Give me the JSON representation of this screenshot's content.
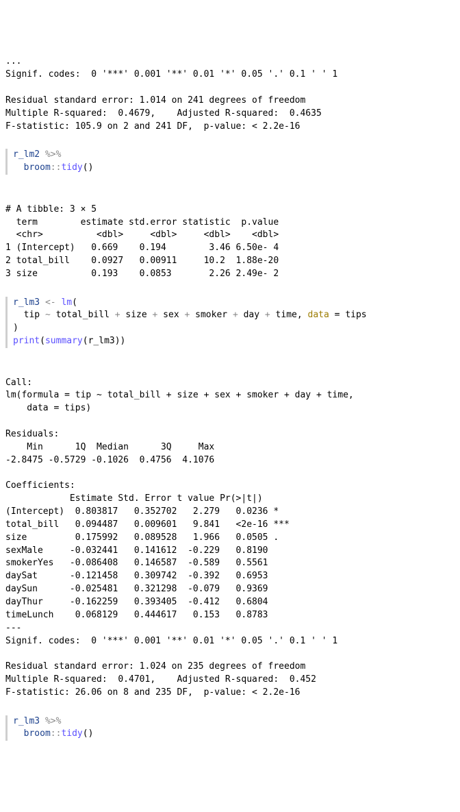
{
  "ellipsis": "...",
  "signif_line1": "Signif. codes:  0 '***' 0.001 '**' 0.01 '*' 0.05 '.' 0.1 ' ' 1",
  "rse_line1": "Residual standard error: 1.014 on 241 degrees of freedom",
  "r2_line1": "Multiple R-squared:  0.4679,    Adjusted R-squared:  0.4635",
  "fstat_line1": "F-statistic: 105.9 on 2 and 241 DF,  p-value: < 2.2e-16",
  "code1": {
    "obj": "r_lm2",
    "pipe": " %>%",
    "indent": "  ",
    "pkg": "broom",
    "coloncolon": "::",
    "fn": "tidy",
    "paren": "()"
  },
  "tibble_header": "# A tibble: 3 × 5",
  "tibble_cols": "  term        estimate std.error statistic  p.value",
  "tibble_types": "  <chr>          <dbl>     <dbl>     <dbl>    <dbl>",
  "tibble_row1": "1 (Intercept)   0.669    0.194        3.46 6.50e- 4",
  "tibble_row2": "2 total_bill    0.0927   0.00911     10.2  1.88e-20",
  "tibble_row3": "3 size          0.193    0.0853       2.26 2.49e- 2",
  "code2": {
    "l1a": "r_lm3",
    "l1b": " <- ",
    "l1c": "lm",
    "l1d": "(",
    "l2a": "  tip ",
    "l2b": "~",
    "l2c": " total_bill ",
    "l2d": "+",
    "l2e": " size ",
    "l2f": "+",
    "l2g": " sex ",
    "l2h": "+",
    "l2i": " smoker ",
    "l2j": "+",
    "l2k": " day ",
    "l2l": "+",
    "l2m": " time, ",
    "l2n": "data",
    "l2o": " = tips",
    "l3": ")",
    "l4a": "print",
    "l4b": "(",
    "l4c": "summary",
    "l4d": "(r_lm3))"
  },
  "call_hdr": "Call:",
  "call_line": "lm(formula = tip ~ total_bill + size + sex + smoker + day + time,",
  "call_line2": "    data = tips)",
  "resid_hdr": "Residuals:",
  "resid_cols": "    Min      1Q  Median      3Q     Max ",
  "resid_vals": "-2.8475 -0.5729 -0.1026  0.4756  4.1076 ",
  "coef_hdr": "Coefficients:",
  "coef_cols": "            Estimate Std. Error t value Pr(>|t|)    ",
  "coef_r1": "(Intercept)  0.803817   0.352702   2.279   0.0236 *  ",
  "coef_r2": "total_bill   0.094487   0.009601   9.841   <2e-16 ***",
  "coef_r3": "size         0.175992   0.089528   1.966   0.0505 .  ",
  "coef_r4": "sexMale     -0.032441   0.141612  -0.229   0.8190    ",
  "coef_r5": "smokerYes   -0.086408   0.146587  -0.589   0.5561    ",
  "coef_r6": "daySat      -0.121458   0.309742  -0.392   0.6953    ",
  "coef_r7": "daySun      -0.025481   0.321298  -0.079   0.9369    ",
  "coef_r8": "dayThur     -0.162259   0.393405  -0.412   0.6804    ",
  "coef_r9": "timeLunch    0.068129   0.444617   0.153   0.8783    ",
  "dashes": "---",
  "signif_line2": "Signif. codes:  0 '***' 0.001 '**' 0.01 '*' 0.05 '.' 0.1 ' ' 1",
  "rse_line2": "Residual standard error: 1.024 on 235 degrees of freedom",
  "r2_line2": "Multiple R-squared:  0.4701,    Adjusted R-squared:  0.452",
  "fstat_line2": "F-statistic: 26.06 on 8 and 235 DF,  p-value: < 2.2e-16",
  "code3": {
    "obj": "r_lm3",
    "pipe": " %>%",
    "indent": "  ",
    "pkg": "broom",
    "coloncolon": "::",
    "fn": "tidy",
    "paren": "()"
  }
}
